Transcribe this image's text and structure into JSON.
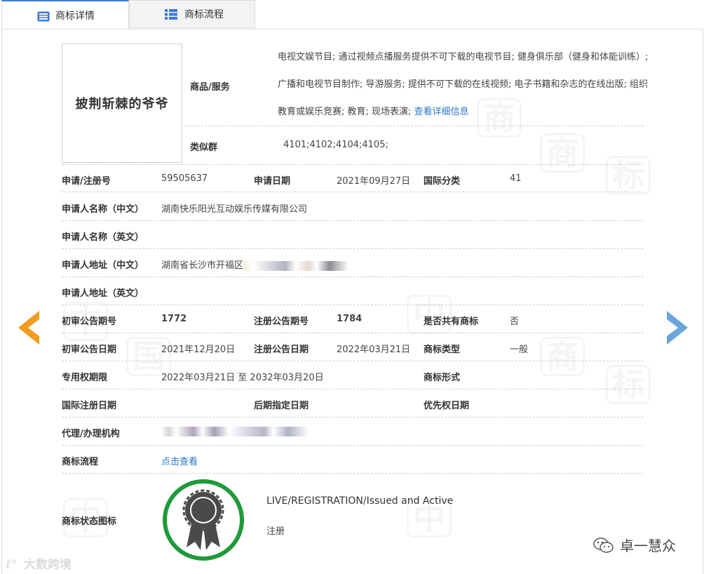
{
  "tabs": [
    {
      "label": "商标详情",
      "active": true,
      "icon": "list-doc-icon"
    },
    {
      "label": "商标流程",
      "active": false,
      "icon": "grid-list-icon"
    }
  ],
  "logo_text": "披荆斩棘的爷爷",
  "goods": {
    "label": "商品/服务",
    "text": "电视文娱节目; 通过视频点播服务提供不可下载的电视节目; 健身俱乐部（健身和体能训练）; 广播和电视节目制作; 导游服务; 提供不可下载的在线视频; 电子书籍和杂志的在线出版; 组织教育或娱乐竞赛; 教育; 现场表演;",
    "more_link": "查看详细信息"
  },
  "similar_group": {
    "label": "类似群",
    "value": "4101;4102;4104;4105;"
  },
  "fields": {
    "reg_no": {
      "label": "申请/注册号",
      "value": "59505637"
    },
    "apply_date": {
      "label": "申请日期",
      "value": "2021年09月27日"
    },
    "intl_class": {
      "label": "国际分类",
      "value": "41"
    },
    "applicant_cn": {
      "label": "申请人名称（中文）",
      "value": "湖南快乐阳光互动娱乐传媒有限公司"
    },
    "applicant_en": {
      "label": "申请人名称（英文）",
      "value": ""
    },
    "address_cn": {
      "label": "申请人地址（中文）",
      "value": "湖南省长沙市开福区"
    },
    "address_en": {
      "label": "申请人地址（英文）",
      "value": ""
    },
    "prelim_issue": {
      "label": "初审公告期号",
      "value": "1772"
    },
    "reg_issue": {
      "label": "注册公告期号",
      "value": "1784"
    },
    "shared": {
      "label": "是否共有商标",
      "value": "否"
    },
    "prelim_date": {
      "label": "初审公告日期",
      "value": "2021年12月20日"
    },
    "reg_date": {
      "label": "注册公告日期",
      "value": "2022年03月21日"
    },
    "tm_type": {
      "label": "商标类型",
      "value": "一般"
    },
    "exclusive_period": {
      "label": "专用权期限",
      "value": "2022年03月21日 至 2032年03月20日"
    },
    "tm_form": {
      "label": "商标形式",
      "value": ""
    },
    "intl_reg_date": {
      "label": "国际注册日期",
      "value": ""
    },
    "later_designation": {
      "label": "后期指定日期",
      "value": ""
    },
    "priority_date": {
      "label": "优先权日期",
      "value": ""
    },
    "agent": {
      "label": "代理/办理机构",
      "value": ""
    },
    "flow": {
      "label": "商标流程",
      "value": "点击查看"
    },
    "status_icon": {
      "label": "商标状态图标"
    }
  },
  "status": {
    "english": "LIVE/REGISTRATION/Issued and Active",
    "chinese": "注册",
    "badge_icon": "rosette-award-icon",
    "ring_color": "#1f9a3a"
  },
  "watermark": {
    "characters": [
      "中",
      "国",
      "商",
      "标"
    ]
  },
  "footer": {
    "left": "大数跨境",
    "right": "卓一慧众"
  },
  "colors": {
    "accent": "#3c78d8",
    "link": "#2b77c9",
    "prev_arrow": "#f39a1e",
    "next_arrow": "#6aa6db"
  }
}
